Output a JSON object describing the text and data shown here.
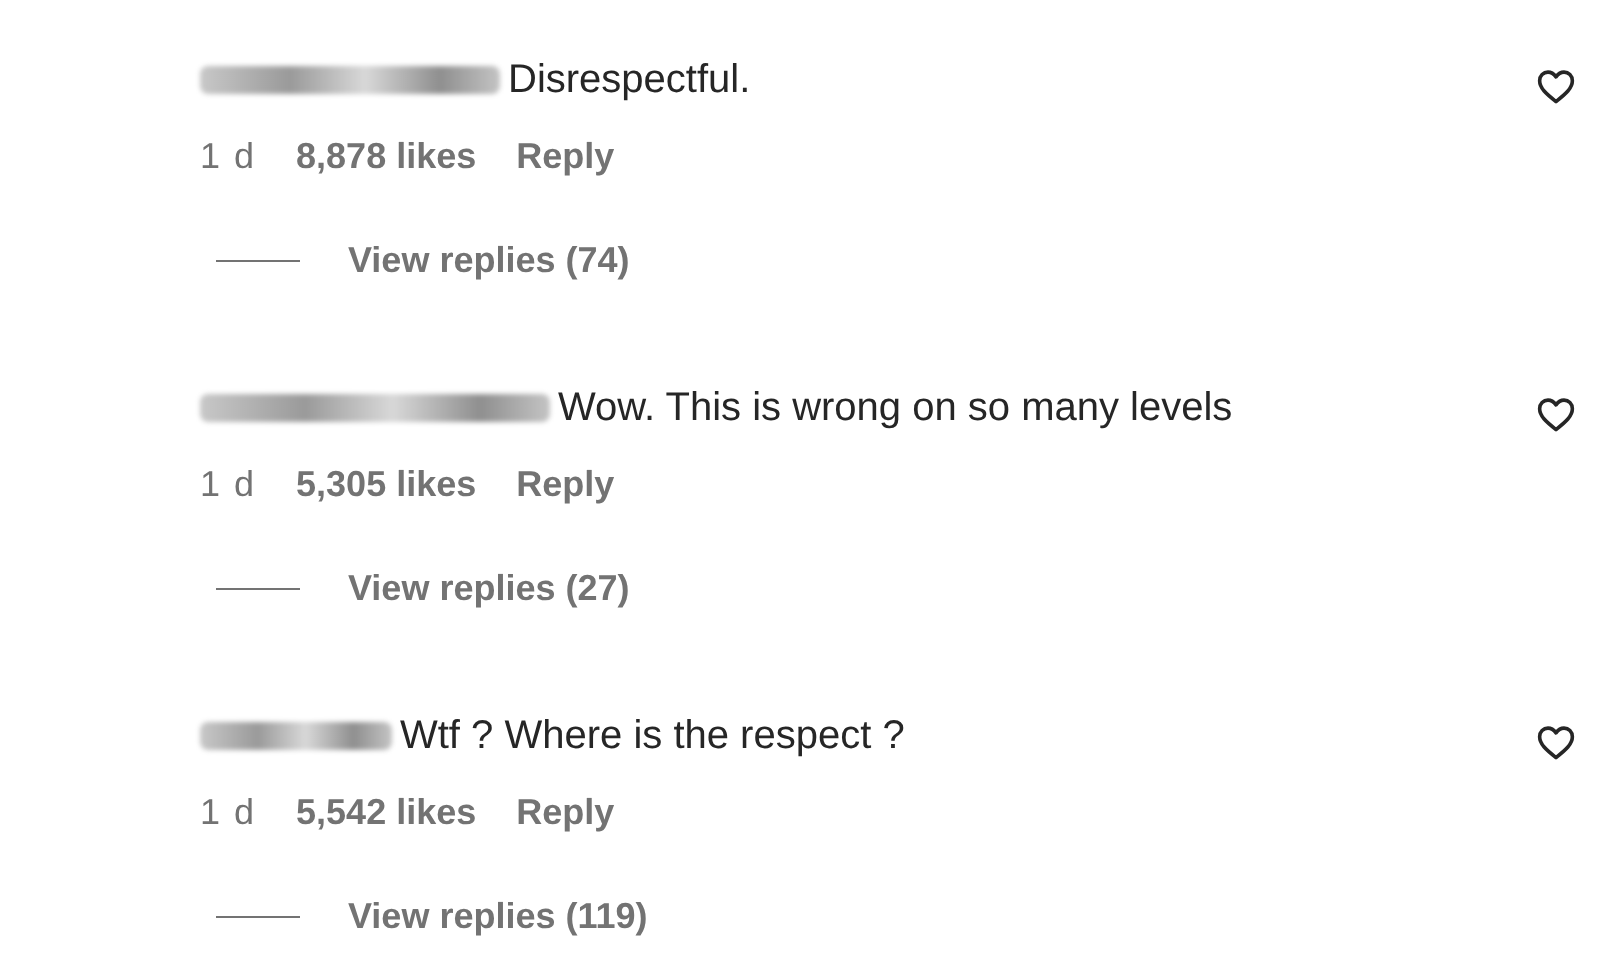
{
  "comments": [
    {
      "username": {
        "kind": "blurred"
      },
      "text": "Disrespectful.",
      "time": "1 d",
      "likes": "8,878 likes",
      "reply": "Reply",
      "view_replies": "View replies (74)"
    },
    {
      "username": {
        "kind": "blurred"
      },
      "text": "Wow. This is wrong on so many levels",
      "time": "1 d",
      "likes": "5,305 likes",
      "reply": "Reply",
      "view_replies": "View replies (27)"
    },
    {
      "username": {
        "kind": "blurred"
      },
      "text": "Wtf ? Where is the respect ?",
      "time": "1 d",
      "likes": "5,542 likes",
      "reply": "Reply",
      "view_replies": "View replies (119)"
    }
  ]
}
